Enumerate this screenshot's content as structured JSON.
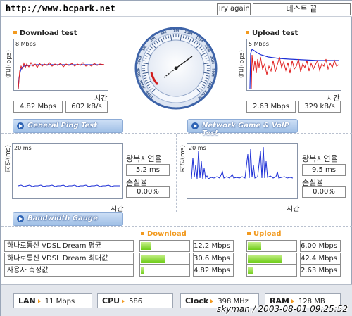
{
  "topbar": {
    "url": "http://www.bcpark.net",
    "try_again": "Try again",
    "status": "테스트 끝"
  },
  "download": {
    "title": "Download test",
    "ylabel": "속도(bps)",
    "scale": "8 Mbps",
    "xlabel": "시간",
    "mbps": "4.82 Mbps",
    "kbs": "602 kB/s"
  },
  "upload": {
    "title": "Upload test",
    "ylabel": "속도(bps)",
    "scale": "5 Mbps",
    "xlabel": "시간",
    "mbps": "2.63 Mbps",
    "kbs": "329 kB/s"
  },
  "ping": {
    "section": "General Ping Test",
    "ylabel": "지연(ms)",
    "scale": "20 ms",
    "xlabel": "시간",
    "rtt_label": "왕복지연율",
    "rtt": "5.2 ms",
    "loss_label": "손실율",
    "loss": "0.00%"
  },
  "game": {
    "section": "Network Game & VoIP Test",
    "ylabel": "지연(ms)",
    "scale": "20 ms",
    "xlabel": "시간",
    "rtt_label": "왕복지연율",
    "rtt": "9.5 ms",
    "loss_label": "손실율",
    "loss": "0.00%"
  },
  "gauge": {
    "section": "Bandwidth Gauge",
    "download_header": "Download",
    "upload_header": "Upload",
    "rows": [
      {
        "label": "하나로통신 VDSL Dream 평균",
        "down": "12.2 Mbps",
        "down_frac": 0.2,
        "up": "6.00 Mbps",
        "up_frac": 0.28
      },
      {
        "label": "하나로통신 VDSL Dream 최대값",
        "down": "30.6 Mbps",
        "down_frac": 0.5,
        "up": "42.4 Mbps",
        "up_frac": 0.72
      },
      {
        "label": "사용자 측정값",
        "down": "4.82 Mbps",
        "down_frac": 0.08,
        "up": "2.63 Mbps",
        "up_frac": 0.12
      }
    ]
  },
  "info": {
    "lan_label": "LAN",
    "lan_value": "11 Mbps",
    "cpu_label": "CPU",
    "cpu_value": "586",
    "clock_label": "Clock",
    "clock_value": "398 MHz",
    "ram_label": "RAM",
    "ram_value": "128 MB"
  },
  "watermark": "skyman / 2003-08-01 09:25:52",
  "dial": {
    "labels": [
      "100k",
      "300k",
      "500k",
      "700k",
      "1M",
      "3M",
      "5M",
      "7M",
      "10M",
      "15M",
      "20M",
      "30M",
      "50M",
      "70M",
      "100M"
    ]
  }
}
